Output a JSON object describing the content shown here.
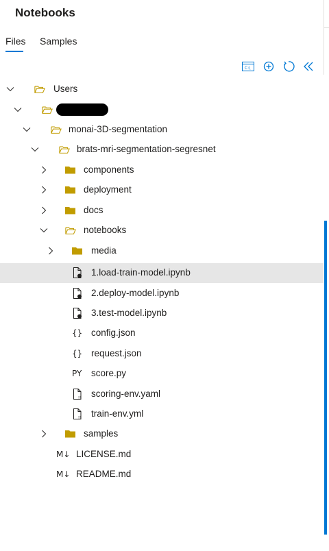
{
  "header": {
    "title": "Notebooks"
  },
  "tabs": [
    {
      "label": "Files",
      "active": true
    },
    {
      "label": "Samples",
      "active": false
    }
  ],
  "toolbar": {
    "icons": [
      "terminal-icon",
      "add-icon",
      "refresh-icon",
      "collapse-icon"
    ]
  },
  "tree": [
    {
      "label": "Users",
      "type": "folder-open",
      "expanded": true
    },
    {
      "label": "",
      "type": "folder-open",
      "expanded": true,
      "redacted": true
    },
    {
      "label": "monai-3D-segmentation",
      "type": "folder-open",
      "expanded": true
    },
    {
      "label": "brats-mri-segmentation-segresnet",
      "type": "folder-open",
      "expanded": true
    },
    {
      "label": "components",
      "type": "folder",
      "expanded": false
    },
    {
      "label": "deployment",
      "type": "folder",
      "expanded": false
    },
    {
      "label": "docs",
      "type": "folder",
      "expanded": false
    },
    {
      "label": "notebooks",
      "type": "folder-open",
      "expanded": true
    },
    {
      "label": "media",
      "type": "folder",
      "expanded": false
    },
    {
      "label": "1.load-train-model.ipynb",
      "type": "notebook",
      "selected": true
    },
    {
      "label": "2.deploy-model.ipynb",
      "type": "notebook"
    },
    {
      "label": "3.test-model.ipynb",
      "type": "notebook"
    },
    {
      "label": "config.json",
      "type": "json",
      "icon_text": "{}"
    },
    {
      "label": "request.json",
      "type": "json",
      "icon_text": "{}"
    },
    {
      "label": "score.py",
      "type": "python",
      "icon_text": "PY"
    },
    {
      "label": "scoring-env.yaml",
      "type": "yaml"
    },
    {
      "label": "train-env.yml",
      "type": "yaml"
    },
    {
      "label": "samples",
      "type": "folder",
      "expanded": false
    },
    {
      "label": "LICENSE.md",
      "type": "markdown",
      "icon_text": "M↓"
    },
    {
      "label": "README.md",
      "type": "markdown",
      "icon_text": "M↓"
    }
  ],
  "colors": {
    "accent": "#0078d4",
    "folder": "#c19c00",
    "selected_row": "#e6e6e6"
  }
}
